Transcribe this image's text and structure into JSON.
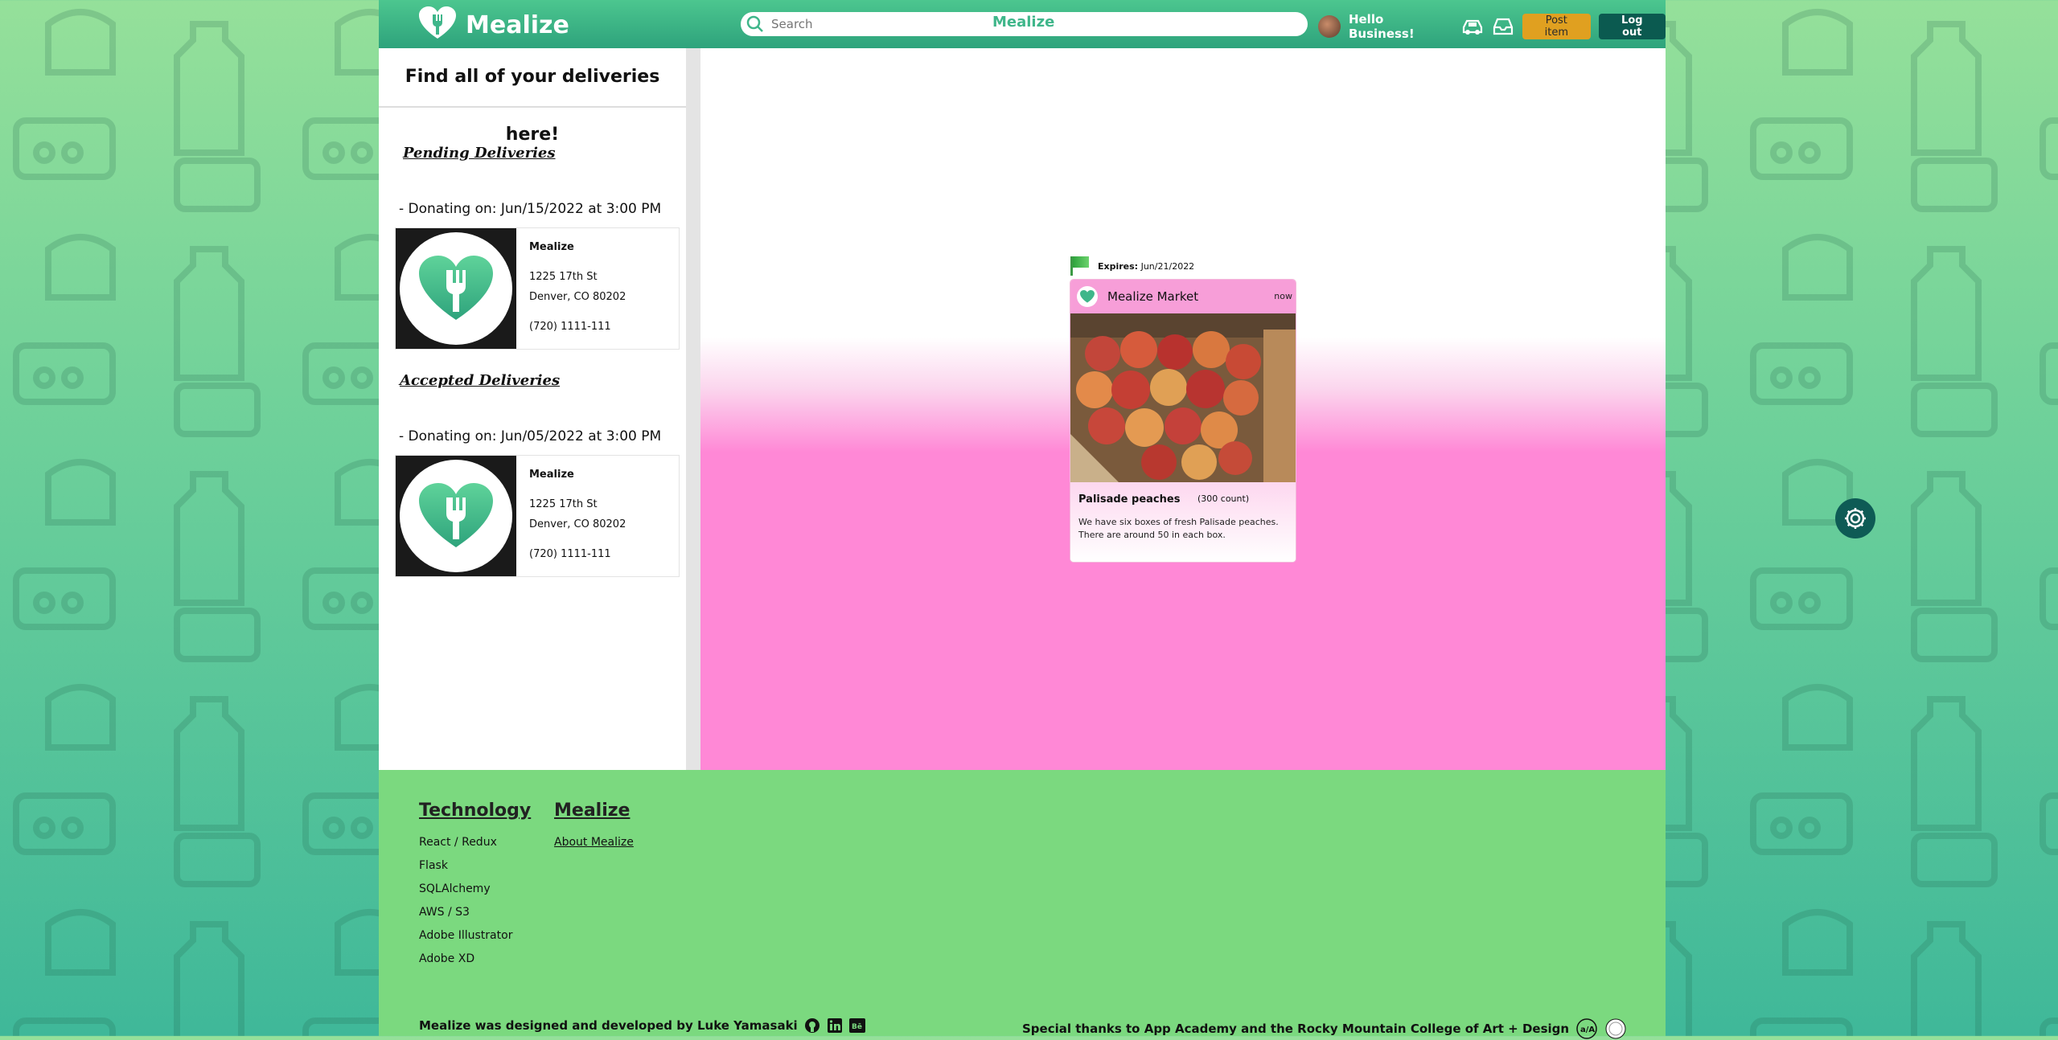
{
  "app": {
    "brand": "Mealize",
    "search_placeholder": "Search",
    "search_brand": "Mealize",
    "greeting": "Hello Business!",
    "post_item_label": "Post item",
    "logout_label": "Log out"
  },
  "sidebar": {
    "heading": "Find all of your deliveries here!",
    "pending_title": "Pending Deliveries",
    "accepted_title": "Accepted Deliveries",
    "pending": {
      "donating": "- Donating on: Jun/15/2022 at 3:00 PM",
      "name": "Mealize",
      "street": "1225 17th St",
      "city": "Denver, CO 80202",
      "phone": "(720) 1111-111"
    },
    "accepted": {
      "donating": "- Donating on: Jun/05/2022 at 3:00 PM",
      "name": "Mealize",
      "street": "1225 17th St",
      "city": "Denver, CO 80202",
      "phone": "(720) 1111-111"
    }
  },
  "post": {
    "expires_label": "Expires:",
    "expires_date": "Jun/21/2022",
    "vendor": "Mealize Market",
    "time": "now",
    "item_name": "Palisade peaches",
    "quantity": "(300 count)",
    "description": "We have six boxes of fresh Palisade peaches. There are around 50 in each box."
  },
  "footer": {
    "tech_title": "Technology",
    "tech_items": [
      "React / Redux",
      "Flask",
      "SQLAlchemy",
      "AWS / S3",
      "Adobe Illustrator",
      "Adobe XD"
    ],
    "mealize_title": "Mealize",
    "about_link": "About Mealize",
    "credit": "Mealize was designed and developed by Luke Yamasaki",
    "thanks": "Special thanks to App Academy and the Rocky Mountain College of Art + Design"
  },
  "colors": {
    "topbar": "#3fb68a",
    "accent_pink": "#ff88d6",
    "footer_green": "#7bd97f",
    "post_button": "#e0a020",
    "logout_button": "#0b5a50"
  },
  "icons": [
    "heart-fork-logo-icon",
    "search-icon",
    "car-icon",
    "inbox-icon",
    "flag-icon",
    "github-icon",
    "linkedin-icon",
    "behance-icon",
    "app-academy-icon",
    "rmcad-icon",
    "gear-icon"
  ]
}
